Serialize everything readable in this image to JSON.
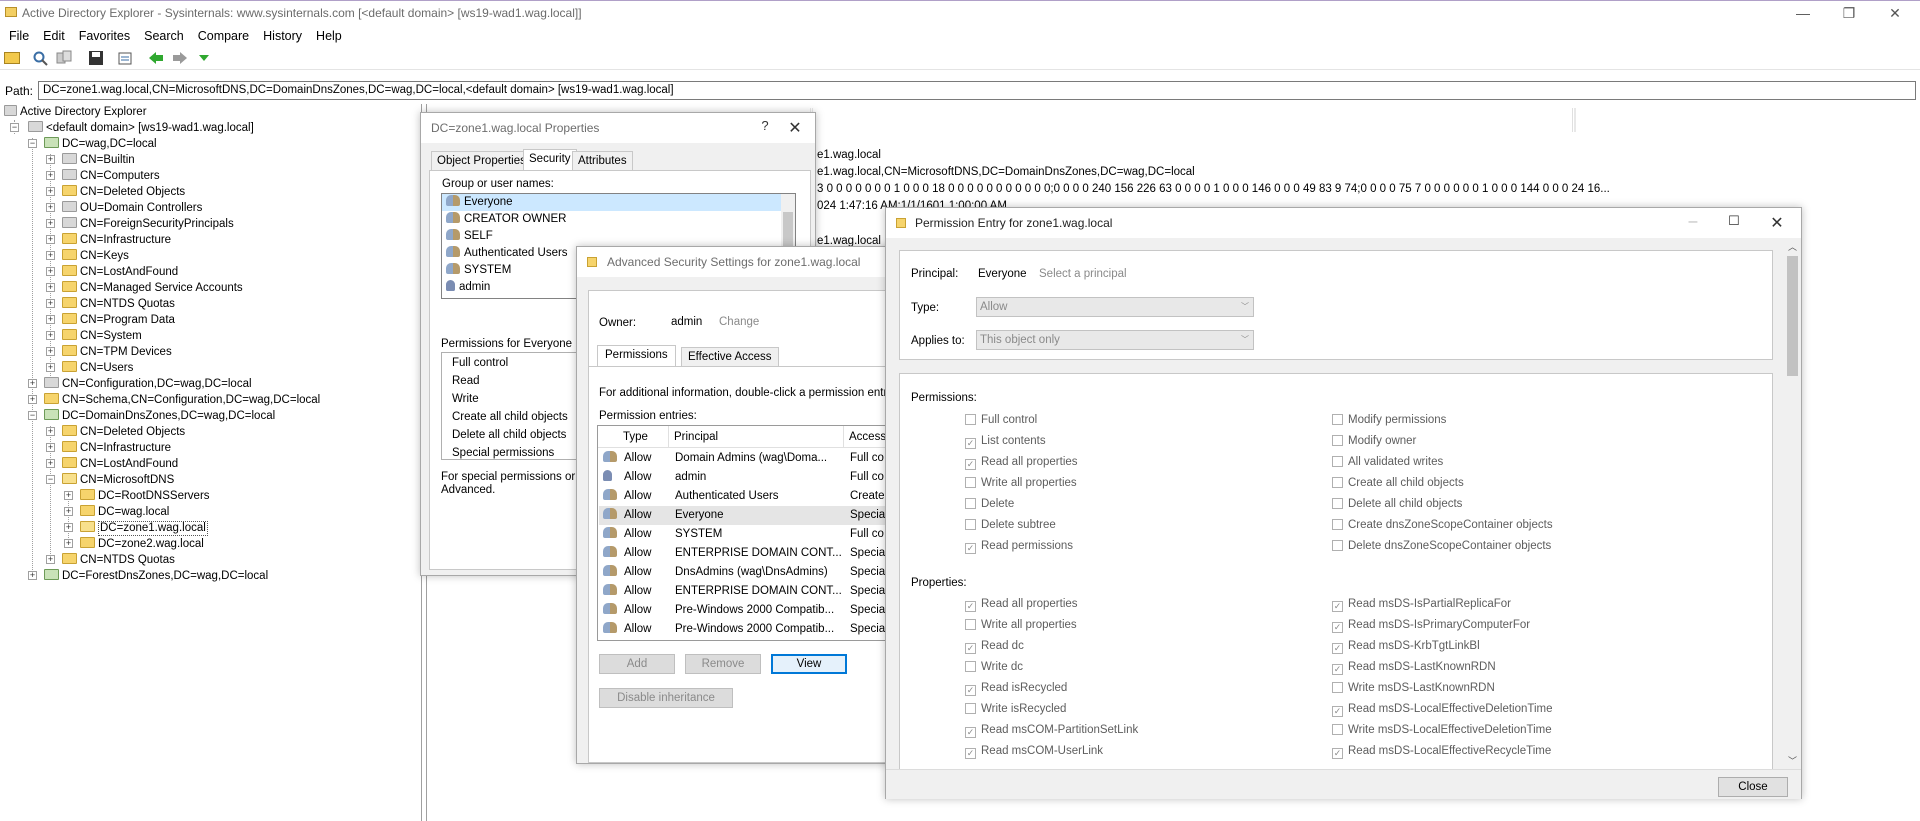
{
  "app": {
    "title": "Active Directory Explorer - Sysinternals: www.sysinternals.com [<default domain> [ws19-wad1.wag.local]]",
    "min_glyph": "—",
    "max_glyph": "❐",
    "close_glyph": "✕"
  },
  "menu": [
    "File",
    "Edit",
    "Favorites",
    "Search",
    "Compare",
    "History",
    "Help"
  ],
  "path": {
    "label": "Path:",
    "value": "DC=zone1.wag.local,CN=MicrosoftDNS,DC=DomainDnsZones,DC=wag,DC=local,<default domain> [ws19-wad1.wag.local]"
  },
  "tree": [
    "Active Directory Explorer",
    "<default domain> [ws19-wad1.wag.local]",
    "DC=wag,DC=local",
    "CN=Builtin",
    "CN=Computers",
    "CN=Deleted Objects",
    "OU=Domain Controllers",
    "CN=ForeignSecurityPrincipals",
    "CN=Infrastructure",
    "CN=Keys",
    "CN=LostAndFound",
    "CN=Managed Service Accounts",
    "CN=NTDS Quotas",
    "CN=Program Data",
    "CN=System",
    "CN=TPM Devices",
    "CN=Users",
    "CN=Configuration,DC=wag,DC=local",
    "CN=Schema,CN=Configuration,DC=wag,DC=local",
    "DC=DomainDnsZones,DC=wag,DC=local",
    "CN=Deleted Objects",
    "CN=Infrastructure",
    "CN=LostAndFound",
    "CN=MicrosoftDNS",
    "DC=RootDNSServers",
    "DC=wag.local",
    "DC=zone1.wag.local",
    "DC=zone2.wag.local",
    "CN=NTDS Quotas",
    "DC=ForestDnsZones,DC=wag,DC=local"
  ],
  "right_pane": {
    "line1": "e1.wag.local",
    "line2": "e1.wag.local,CN=MicrosoftDNS,DC=DomainDnsZones,DC=wag,DC=local",
    "line3": "3 0 0 0 0 0 0 0 1 0 0 0 18 0 0 0 0 0 0 0 0 0 0 0;0 0 0 0 240 156 226 63 0 0 0 0 1 0 0 0 146 0 0 0 49 83 9 74;0 0 0 0 75 7 0 0 0 0 0 0 1 0 0 0 144 0 0 0 24 16...",
    "line4": "024 1:47:16 AM;1/1/1601 1:00:00 AM",
    "line5": "e1.wag.local"
  },
  "props_dialog": {
    "title": "DC=zone1.wag.local Properties",
    "help": "?",
    "tabs": [
      "Object Properties",
      "Security",
      "Attributes"
    ],
    "group_label": "Group or user names:",
    "users": [
      "Everyone",
      "CREATOR OWNER",
      "SELF",
      "Authenticated Users",
      "SYSTEM",
      "admin"
    ],
    "perms_label": "Permissions for Everyone",
    "perms": [
      "Full control",
      "Read",
      "Write",
      "Create all child objects",
      "Delete all child objects",
      "Special permissions"
    ],
    "note1": "For special permissions or ad",
    "note2": "Advanced."
  },
  "adv_dialog": {
    "title": "Advanced Security Settings for zone1.wag.local",
    "owner_label": "Owner:",
    "owner": "admin",
    "change": "Change",
    "tabs": [
      "Permissions",
      "Effective Access"
    ],
    "info": "For additional information, double-click a permission entry",
    "entries_label": "Permission entries:",
    "columns": [
      "Type",
      "Principal",
      "Access"
    ],
    "rows": [
      {
        "type": "Allow",
        "principal": "Domain Admins (wag\\Doma...",
        "access": "Full co"
      },
      {
        "type": "Allow",
        "principal": "admin",
        "access": "Full co"
      },
      {
        "type": "Allow",
        "principal": "Authenticated Users",
        "access": "Create"
      },
      {
        "type": "Allow",
        "principal": "Everyone",
        "access": "Special"
      },
      {
        "type": "Allow",
        "principal": "SYSTEM",
        "access": "Full co"
      },
      {
        "type": "Allow",
        "principal": "ENTERPRISE DOMAIN CONT...",
        "access": "Special"
      },
      {
        "type": "Allow",
        "principal": "DnsAdmins (wag\\DnsAdmins)",
        "access": "Special"
      },
      {
        "type": "Allow",
        "principal": "ENTERPRISE DOMAIN CONT...",
        "access": "Special"
      },
      {
        "type": "Allow",
        "principal": "Pre-Windows 2000 Compatib...",
        "access": "Special"
      },
      {
        "type": "Allow",
        "principal": "Pre-Windows 2000 Compatib...",
        "access": "Special"
      }
    ],
    "buttons": {
      "add": "Add",
      "remove": "Remove",
      "view": "View",
      "disable": "Disable inheritance"
    }
  },
  "perm_entry": {
    "title": "Permission Entry for zone1.wag.local",
    "principal_label": "Principal:",
    "principal": "Everyone",
    "select_principal": "Select a principal",
    "type_label": "Type:",
    "type_value": "Allow",
    "applies_label": "Applies to:",
    "applies_value": "This object only",
    "permissions_label": "Permissions:",
    "permissions_left": [
      {
        "label": "Full control",
        "checked": false
      },
      {
        "label": "List contents",
        "checked": true
      },
      {
        "label": "Read all properties",
        "checked": true
      },
      {
        "label": "Write all properties",
        "checked": false
      },
      {
        "label": "Delete",
        "checked": false
      },
      {
        "label": "Delete subtree",
        "checked": false
      },
      {
        "label": "Read permissions",
        "checked": true
      }
    ],
    "permissions_right": [
      {
        "label": "Modify permissions",
        "checked": false
      },
      {
        "label": "Modify owner",
        "checked": false
      },
      {
        "label": "All validated writes",
        "checked": false
      },
      {
        "label": "Create all child objects",
        "checked": false
      },
      {
        "label": "Delete all child objects",
        "checked": false
      },
      {
        "label": "Create dnsZoneScopeContainer objects",
        "checked": false
      },
      {
        "label": "Delete dnsZoneScopeContainer objects",
        "checked": false
      }
    ],
    "properties_label": "Properties:",
    "properties_left": [
      {
        "label": "Read all properties",
        "checked": true
      },
      {
        "label": "Write all properties",
        "checked": false
      },
      {
        "label": "Read dc",
        "checked": true
      },
      {
        "label": "Write dc",
        "checked": false
      },
      {
        "label": "Read isRecycled",
        "checked": true
      },
      {
        "label": "Write isRecycled",
        "checked": false
      },
      {
        "label": "Read msCOM-PartitionSetLink",
        "checked": true
      },
      {
        "label": "Read msCOM-UserLink",
        "checked": true
      }
    ],
    "properties_right": [
      {
        "label": "Read msDS-IsPartialReplicaFor",
        "checked": true
      },
      {
        "label": "Read msDS-IsPrimaryComputerFor",
        "checked": true
      },
      {
        "label": "Read msDS-KrbTgtLinkBl",
        "checked": true
      },
      {
        "label": "Read msDS-LastKnownRDN",
        "checked": true
      },
      {
        "label": "Write msDS-LastKnownRDN",
        "checked": false
      },
      {
        "label": "Read msDS-LocalEffectiveDeletionTime",
        "checked": true
      },
      {
        "label": "Write msDS-LocalEffectiveDeletionTime",
        "checked": false
      },
      {
        "label": "Read msDS-LocalEffectiveRecycleTime",
        "checked": true
      }
    ],
    "close": "Close"
  }
}
